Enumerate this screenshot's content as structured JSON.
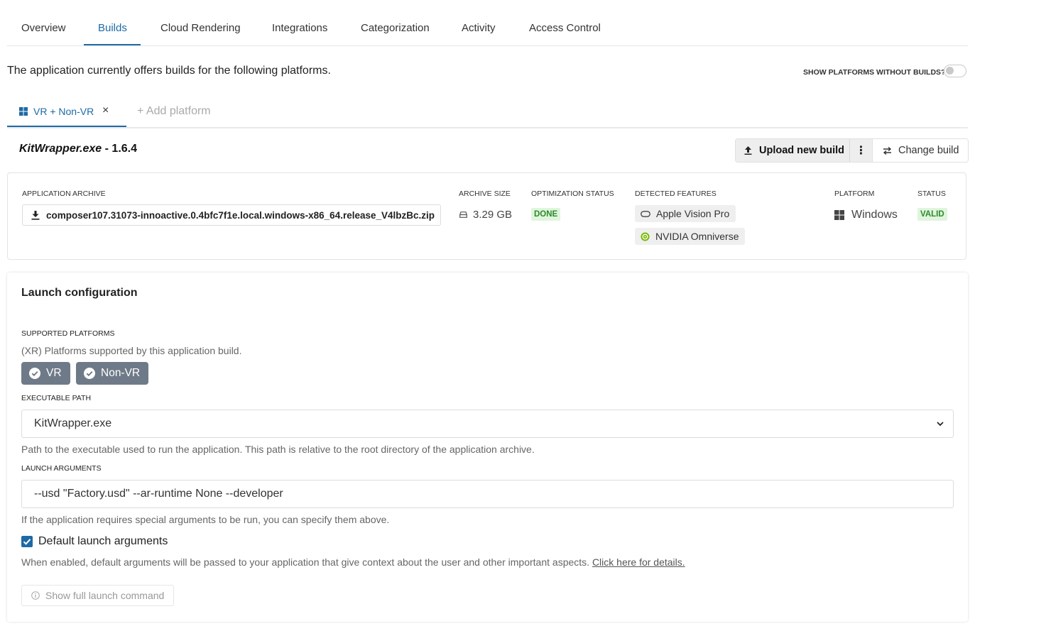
{
  "tabs": [
    "Overview",
    "Builds",
    "Cloud Rendering",
    "Integrations",
    "Categorization",
    "Activity",
    "Access Control"
  ],
  "active_tab": "Builds",
  "intro_text": "The application currently offers builds for the following platforms.",
  "toggle_label": "SHOW PLATFORMS WITHOUT BUILDS?",
  "platform_tab": {
    "label": "VR + Non-VR",
    "close": "×",
    "add_label": "+ Add platform"
  },
  "build": {
    "exe": "KitWrapper.exe",
    "version": " - 1.6.4",
    "upload_label": "Upload new build",
    "more_label": "⋮",
    "change_label": "Change build"
  },
  "archive": {
    "labels": {
      "archive": "APPLICATION ARCHIVE",
      "size": "ARCHIVE SIZE",
      "optimization": "OPTIMIZATION STATUS",
      "features": "DETECTED FEATURES",
      "platform": "PLATFORM",
      "status": "STATUS"
    },
    "file_name": "composer107.31073-innoactive.0.4bfc7f1e.local.windows-x86_64.release_V4lbzBc.zip",
    "size": "3.29 GB",
    "optimization_status": "DONE",
    "features": [
      "Apple Vision Pro",
      "NVIDIA Omniverse"
    ],
    "platform": "Windows",
    "status": "VALID"
  },
  "launch": {
    "title": "Launch configuration",
    "supported_label": "SUPPORTED PLATFORMS",
    "supported_help": "(XR) Platforms supported by this application build.",
    "platforms": [
      "VR",
      "Non-VR"
    ],
    "exe_label": "EXECUTABLE PATH",
    "exe_value": "KitWrapper.exe",
    "exe_help": "Path to the executable used to run the application. This path is relative to the root directory of the application archive.",
    "args_label": "LAUNCH ARGUMENTS",
    "args_value": "--usd \"Factory.usd\" --ar-runtime None --developer",
    "args_help": "If the application requires special arguments to be run, you can specify them above.",
    "default_args_label": "Default launch arguments",
    "default_args_help": "When enabled, default arguments will be passed to your application that give context about the user and other important aspects.",
    "details_link": "Click here for details.",
    "show_cmd_label": "Show full launch command"
  },
  "colors": {
    "accent": "#1d6aa6",
    "status_green": "#2f8a2c",
    "chip_dark": "#6f7a88"
  }
}
